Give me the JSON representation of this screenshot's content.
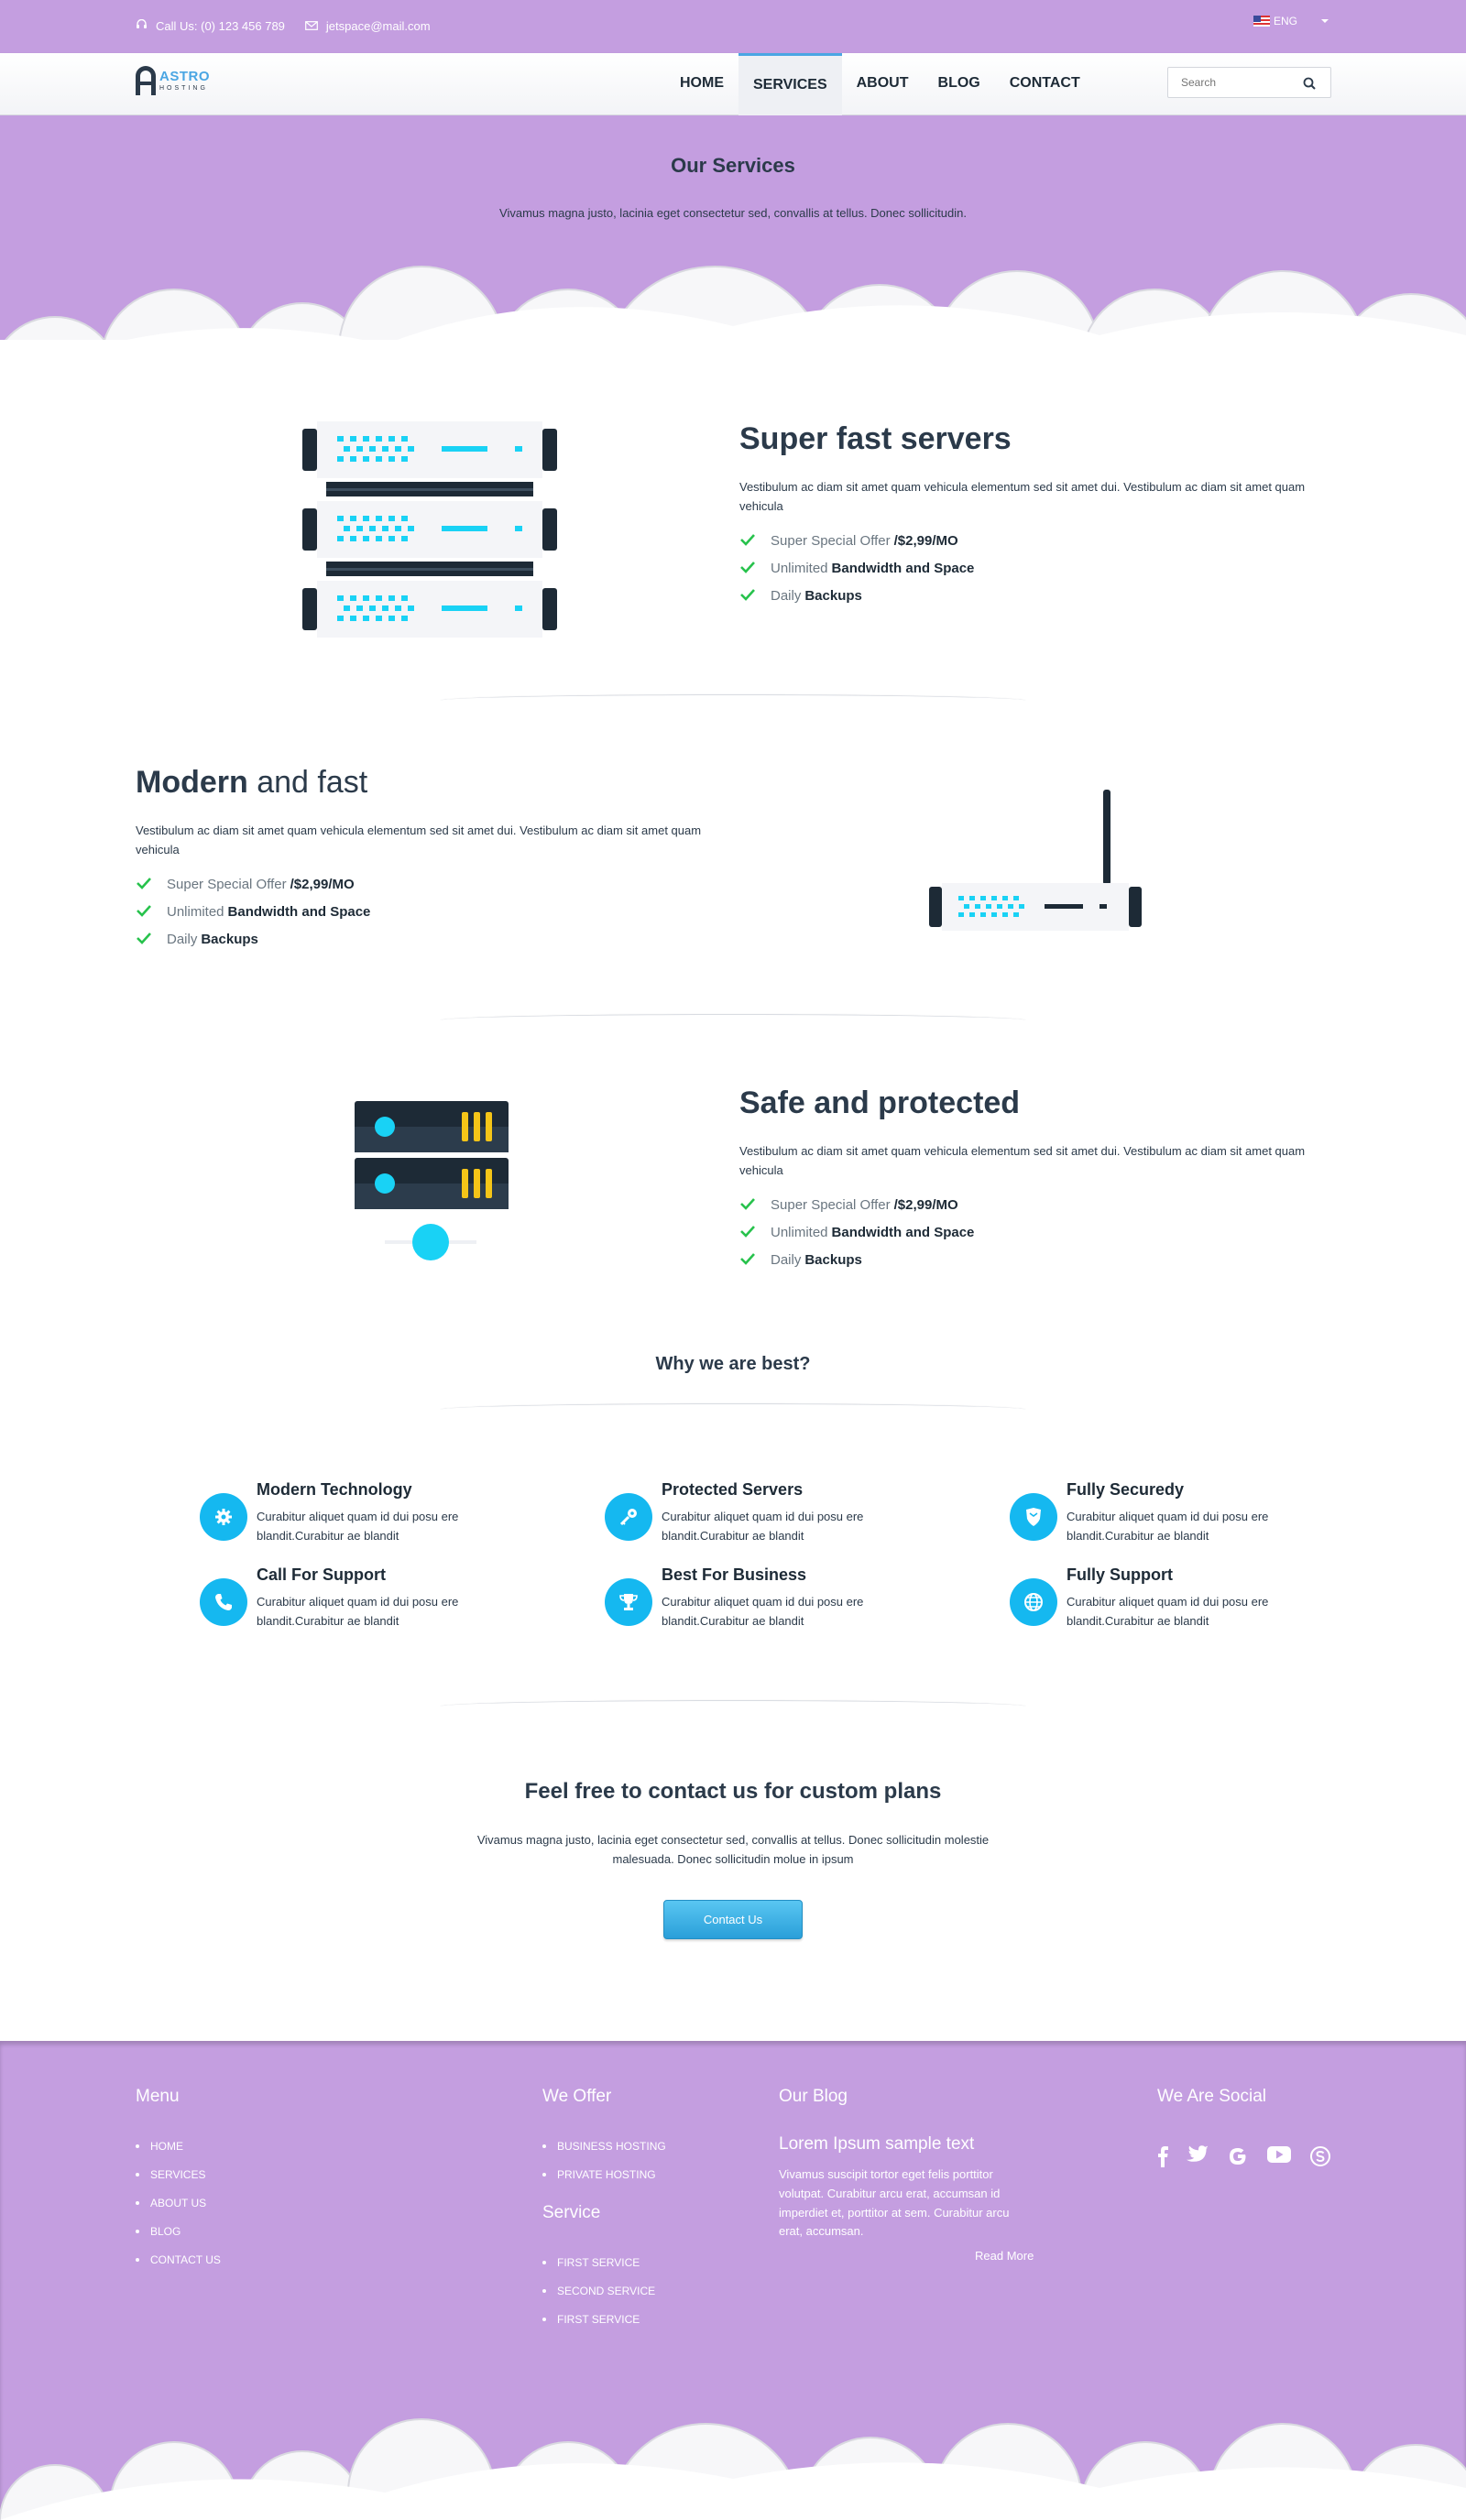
{
  "topbar": {
    "phone": "Call Us: (0) 123 456 789",
    "email": "jetspace@mail.com",
    "language": "ENG"
  },
  "brand": {
    "name": "ASTRO",
    "tagline": "HOSTING"
  },
  "nav": {
    "items": [
      {
        "label": "HOME"
      },
      {
        "label": "SERVICES"
      },
      {
        "label": "ABOUT"
      },
      {
        "label": "BLOG"
      },
      {
        "label": "CONTACT"
      }
    ],
    "active": "SERVICES",
    "search_placeholder": "Search"
  },
  "hero": {
    "title": "Our Services",
    "subtitle": "Vivamus magna justo, lacinia eget consectetur sed, convallis at tellus. Donec sollicitudin."
  },
  "features": [
    {
      "title_bold": "Super fast servers",
      "title_light": "",
      "description": "Vestibulum ac diam sit amet quam vehicula elementum sed sit amet dui. Vestibulum ac diam sit amet quam vehicula",
      "points": [
        {
          "light": "Super Special Offer",
          "bold": "/$2,99/MO"
        },
        {
          "light": "Unlimited",
          "bold": "Bandwidth and Space"
        },
        {
          "light": "Daily",
          "bold": "Backups"
        }
      ]
    },
    {
      "title_bold": "Modern",
      "title_light": "and fast",
      "description": "Vestibulum ac diam sit amet quam vehicula elementum sed sit amet dui. Vestibulum ac diam sit amet quam vehicula",
      "points": [
        {
          "light": "Super Special Offer",
          "bold": "/$2,99/MO"
        },
        {
          "light": "Unlimited",
          "bold": "Bandwidth and Space"
        },
        {
          "light": "Daily",
          "bold": "Backups"
        }
      ]
    },
    {
      "title_bold": "Safe and protected",
      "title_light": "",
      "description": "Vestibulum ac diam sit amet quam vehicula elementum sed sit amet dui. Vestibulum ac diam sit amet quam vehicula",
      "points": [
        {
          "light": "Super Special Offer",
          "bold": "/$2,99/MO"
        },
        {
          "light": "Unlimited",
          "bold": "Bandwidth and Space"
        },
        {
          "light": "Daily",
          "bold": "Backups"
        }
      ]
    }
  ],
  "why": {
    "title": "Why we are best?",
    "items": [
      {
        "title": "Modern Technology",
        "text": "Curabitur aliquet quam id dui posu ere blandit.Curabitur ae blandit",
        "icon": "gear-icon"
      },
      {
        "title": "Protected Servers",
        "text": "Curabitur aliquet quam id dui posu ere blandit.Curabitur ae blandit",
        "icon": "key-icon"
      },
      {
        "title": "Fully Securedy",
        "text": "Curabitur aliquet quam id dui posu ere blandit.Curabitur ae blandit",
        "icon": "shield-icon"
      },
      {
        "title": "Call For Support",
        "text": "Curabitur aliquet quam id dui posu ere blandit.Curabitur ae blandit",
        "icon": "phone-icon"
      },
      {
        "title": "Best For Business",
        "text": "Curabitur aliquet quam id dui posu ere blandit.Curabitur ae blandit",
        "icon": "trophy-icon"
      },
      {
        "title": "Fully Support",
        "text": "Curabitur aliquet quam id dui posu ere blandit.Curabitur ae blandit",
        "icon": "globe-icon"
      }
    ]
  },
  "contact": {
    "title": "Feel free to contact us for custom plans",
    "text": "Vivamus magna justo, lacinia eget consectetur sed, convallis at tellus. Donec sollicitudin molestie malesuada. Donec sollicitudin molue in ipsum",
    "button": "Contact Us"
  },
  "footer": {
    "menu": {
      "title": "Menu",
      "items": [
        "HOME",
        "SERVICES",
        "ABOUT US",
        "BLOG",
        "CONTACT US"
      ]
    },
    "offer": {
      "title": "We Offer",
      "items": [
        "BUSINESS HOSTING",
        "PRIVATE HOSTING"
      ]
    },
    "service": {
      "title": "Service",
      "items": [
        "FIRST SERVICE",
        "SECOND SERVICE",
        "FIRST SERVICE"
      ]
    },
    "blog": {
      "title": "Our Blog",
      "post_title": "Lorem Ipsum sample text",
      "post_text": "Vivamus suscipit tortor eget felis porttitor volutpat. Curabitur arcu erat, accumsan id imperdiet et, porttitor at sem. Curabitur arcu erat, accumsan.",
      "read_more": "Read More"
    },
    "social": {
      "title": "We Are Social",
      "icons": [
        "facebook-icon",
        "twitter-icon",
        "google-icon",
        "youtube-icon",
        "skype-icon"
      ]
    }
  },
  "colors": {
    "purple": "#c49ee0",
    "accent": "#15b8f0",
    "dark": "#2b3a4a",
    "check": "#27c24c",
    "gold": "#f5c518"
  }
}
